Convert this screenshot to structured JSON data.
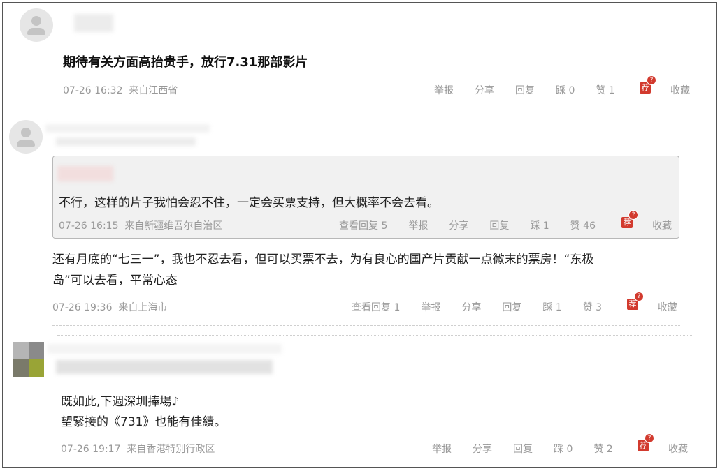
{
  "comments": [
    {
      "text": "期待有关方面高抬贵手，放行7.31那部影片",
      "time": "07-26 16:32",
      "location": "来自江西省",
      "actions": {
        "report": "举报",
        "share": "分享",
        "reply": "回复",
        "downvote": "踩 0",
        "like": "赞 1",
        "collect": "收藏"
      }
    },
    {
      "quote": {
        "text": "不行，这样的片子我怕会忍不住，一定会买票支持，但大概率不会去看。",
        "time": "07-26 16:15",
        "location": "来自新疆维吾尔自治区",
        "actions": {
          "view_replies": "查看回复 5",
          "report": "举报",
          "share": "分享",
          "reply": "回复",
          "downvote": "踩 1",
          "like": "赞 46",
          "collect": "收藏"
        }
      },
      "text_line1": "还有月底的“七三一”，我也不忍去看，但可以买票不去，为有良心的国产片贡献一点微末的票房！“东极",
      "text_line2": "岛”可以去看，平常心态",
      "time": "07-26 19:36",
      "location": "来自上海市",
      "actions": {
        "view_replies": "查看回复 1",
        "report": "举报",
        "share": "分享",
        "reply": "回复",
        "downvote": "踩 1",
        "like": "赞 3",
        "collect": "收藏"
      }
    },
    {
      "text_line1": "既如此,下週深圳捧場♪",
      "text_line2": "望緊接的《731》也能有佳績。",
      "time": "07-26 19:17",
      "location": "来自香港特别行政区",
      "actions": {
        "report": "举报",
        "share": "分享",
        "reply": "回复",
        "downvote": "踩 0",
        "like": "赞 2",
        "collect": "收藏"
      }
    }
  ],
  "recommend_icon": {
    "glyph": "荐",
    "badge": "?",
    "color": "#d23a2e"
  }
}
